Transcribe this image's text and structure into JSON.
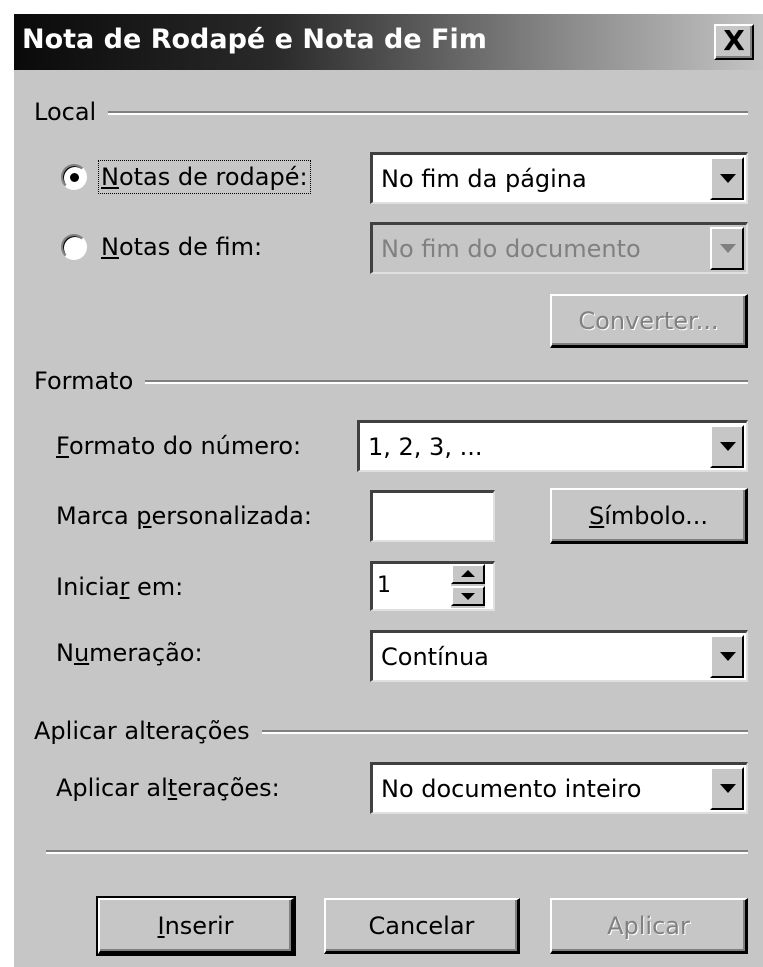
{
  "window": {
    "title": "Nota de Rodapé e Nota de Fim",
    "close_label": "X"
  },
  "local": {
    "group_label": "Local",
    "footnotes": {
      "label_prefix": "",
      "label_accel": "N",
      "label_rest": "otas de rodapé:",
      "selected": true,
      "location_value": "No fim da página"
    },
    "endnotes": {
      "label_accel": "N",
      "label_rest": "otas de fim:",
      "selected": false,
      "location_value": "No fim do documento"
    },
    "convert_label": "Converter..."
  },
  "formato": {
    "group_label": "Formato",
    "number_format": {
      "label_accel": "F",
      "label_rest": "ormato do número:",
      "value": "1, 2, 3, ..."
    },
    "custom_mark": {
      "label_pre": "Marca ",
      "label_accel": "p",
      "label_rest": "ersonalizada:",
      "value": "",
      "symbol_accel": "S",
      "symbol_rest": "ímbolo..."
    },
    "start_at": {
      "label_pre": "Inicia",
      "label_accel": "r",
      "label_rest": " em:",
      "value": "1"
    },
    "numbering": {
      "label_pre": "N",
      "label_accel": "u",
      "label_rest": "meração:",
      "value": "Contínua"
    }
  },
  "apply_changes": {
    "group_label": "Aplicar alterações",
    "label_pre": "Aplicar al",
    "label_accel": "t",
    "label_rest": "erações:",
    "value": "No documento inteiro"
  },
  "buttons": {
    "insert_accel": "I",
    "insert_rest": "nserir",
    "cancel": "Cancelar",
    "apply": "Aplicar"
  }
}
